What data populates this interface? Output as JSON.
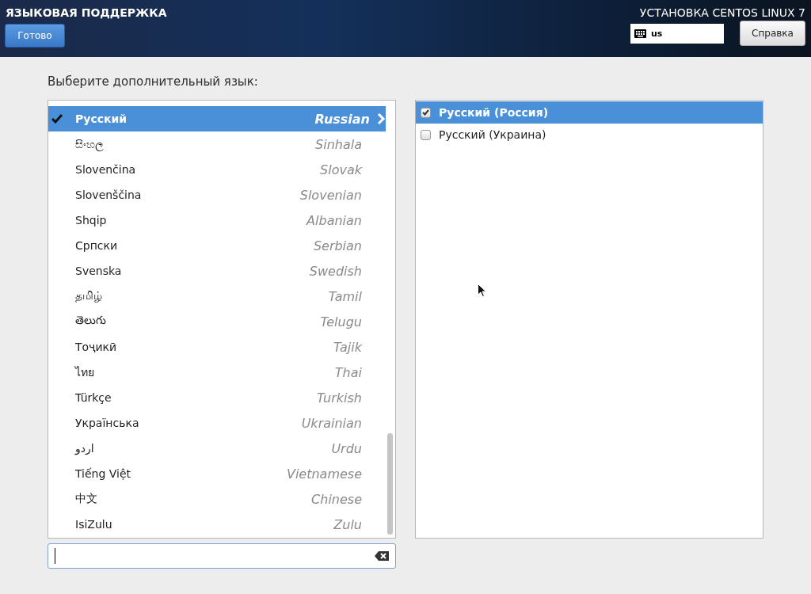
{
  "header": {
    "title": "ЯЗЫКОВАЯ ПОДДЕРЖКА",
    "done_button": "Готово",
    "product": "УСТАНОВКА CENTOS LINUX 7",
    "keyboard_layout": "us",
    "help_button": "Справка"
  },
  "prompt": "Выберите дополнительный язык:",
  "languages": [
    {
      "native": "Русский",
      "english": "Russian",
      "selected": true,
      "checked": true
    },
    {
      "native": "සිංහල",
      "english": "Sinhala",
      "selected": false,
      "checked": false
    },
    {
      "native": "Slovenčina",
      "english": "Slovak",
      "selected": false,
      "checked": false
    },
    {
      "native": "Slovenščina",
      "english": "Slovenian",
      "selected": false,
      "checked": false
    },
    {
      "native": "Shqip",
      "english": "Albanian",
      "selected": false,
      "checked": false
    },
    {
      "native": "Српски",
      "english": "Serbian",
      "selected": false,
      "checked": false
    },
    {
      "native": "Svenska",
      "english": "Swedish",
      "selected": false,
      "checked": false
    },
    {
      "native": "தமிழ்",
      "english": "Tamil",
      "selected": false,
      "checked": false
    },
    {
      "native": "తెలుగు",
      "english": "Telugu",
      "selected": false,
      "checked": false
    },
    {
      "native": "Тоҷикӣ",
      "english": "Tajik",
      "selected": false,
      "checked": false
    },
    {
      "native": "ไทย",
      "english": "Thai",
      "selected": false,
      "checked": false
    },
    {
      "native": "Türkçe",
      "english": "Turkish",
      "selected": false,
      "checked": false
    },
    {
      "native": "Українська",
      "english": "Ukrainian",
      "selected": false,
      "checked": false
    },
    {
      "native": "اردو",
      "english": "Urdu",
      "selected": false,
      "checked": false
    },
    {
      "native": "Tiếng Việt",
      "english": "Vietnamese",
      "selected": false,
      "checked": false
    },
    {
      "native": "中文",
      "english": "Chinese",
      "selected": false,
      "checked": false
    },
    {
      "native": "IsiZulu",
      "english": "Zulu",
      "selected": false,
      "checked": false
    }
  ],
  "locales": [
    {
      "label": "Русский (Россия)",
      "selected": true,
      "checked": true
    },
    {
      "label": "Русский (Украина)",
      "selected": false,
      "checked": false
    }
  ]
}
